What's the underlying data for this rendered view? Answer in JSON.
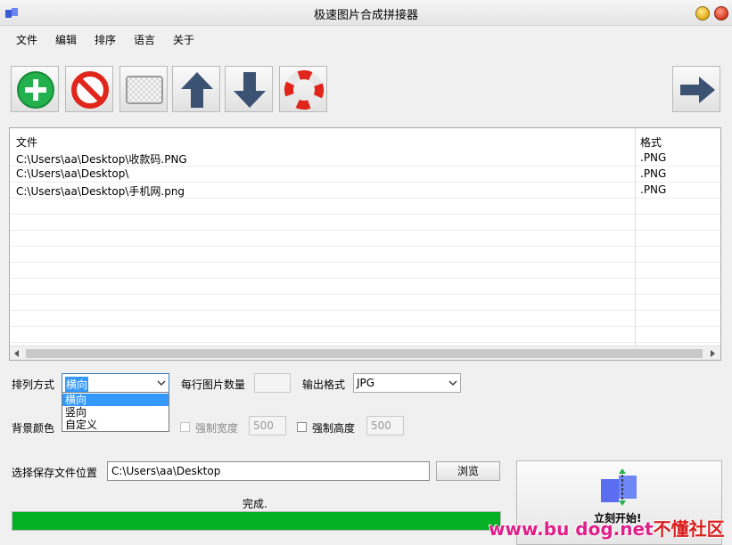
{
  "window": {
    "title": "极速图片合成拼接器"
  },
  "menu": [
    "文件",
    "编辑",
    "排序",
    "语言",
    "关于"
  ],
  "toolbar": {
    "buttons": [
      "add-icon",
      "remove-icon",
      "clear-icon",
      "move-up-icon",
      "move-down-icon",
      "help-icon"
    ],
    "next": "next-arrow-icon"
  },
  "filelist": {
    "headers": {
      "file": "文件",
      "format": "格式"
    },
    "rows": [
      {
        "file": "C:\\Users\\aa\\Desktop\\收款码.PNG",
        "format": ".PNG"
      },
      {
        "file": "C:\\Users\\aa\\Desktop\\",
        "format": ".PNG"
      },
      {
        "file": "C:\\Users\\aa\\Desktop\\手机网.png",
        "format": ".PNG"
      }
    ]
  },
  "options": {
    "arrange_label": "排列方式",
    "arrange_value": "横向",
    "arrange_options": [
      "横向",
      "竖向",
      "自定义"
    ],
    "per_row_label": "每行图片数量",
    "per_row_value": "",
    "output_format_label": "输出格式",
    "output_format_value": "JPG",
    "bg_color_label": "背景颜色",
    "force_width_label": "强制宽度",
    "force_width_value": "500",
    "force_height_label": "强制高度",
    "force_height_value": "500"
  },
  "save": {
    "label": "选择保存文件位置",
    "path": "C:\\Users\\aa\\Desktop",
    "browse": "浏览"
  },
  "status": {
    "text": "完成.",
    "progress": 1.0
  },
  "start": {
    "label": "立刻开始!"
  },
  "watermark": {
    "part1": "www.bu dog.net",
    "part2": "不懂社区"
  },
  "colors": {
    "progress": "#06b025",
    "selection": "#3399ff"
  }
}
